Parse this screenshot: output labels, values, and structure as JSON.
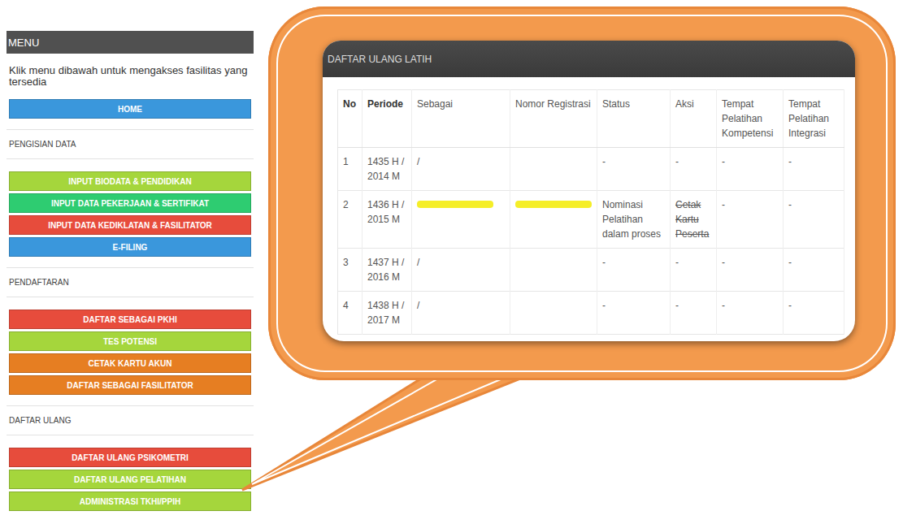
{
  "sidebar": {
    "title": "MENU",
    "intro": "Klik menu dibawah untuk mengakses fasilitas yang tersedia",
    "top_items": [
      {
        "label": "HOME",
        "color": "#3a97dc"
      }
    ],
    "sections": [
      {
        "label": "PENGISIAN DATA",
        "items": [
          {
            "label": "INPUT BIODATA & PENDIDIKAN",
            "color": "#a5d63c"
          },
          {
            "label": "INPUT DATA PEKERJAAN & SERTIFIKAT",
            "color": "#2ecc71"
          },
          {
            "label": "INPUT DATA KEDIKLATAN & FASILITATOR",
            "color": "#e74c3c"
          },
          {
            "label": "E-FILING",
            "color": "#3a97dc"
          }
        ]
      },
      {
        "label": "PENDAFTARAN",
        "items": [
          {
            "label": "DAFTAR SEBAGAI PKHI",
            "color": "#e74c3c"
          },
          {
            "label": "TES POTENSI",
            "color": "#a5d63c"
          },
          {
            "label": "CETAK KARTU AKUN",
            "color": "#e67e22"
          },
          {
            "label": "DAFTAR SEBAGAI FASILITATOR",
            "color": "#e67e22"
          }
        ]
      },
      {
        "label": "DAFTAR ULANG",
        "items": [
          {
            "label": "DAFTAR ULANG PSIKOMETRI",
            "color": "#e74c3c"
          },
          {
            "label": "DAFTAR ULANG PELATIHAN",
            "color": "#a5d63c"
          },
          {
            "label": "ADMINISTRASI TKHI/PPIH",
            "color": "#a5d63c"
          }
        ]
      }
    ]
  },
  "callout": {
    "panel_title": "DAFTAR ULANG LATIH",
    "table": {
      "columns": [
        {
          "label": "No",
          "bold": true
        },
        {
          "label": "Periode",
          "bold": true
        },
        {
          "label": "Sebagai",
          "bold": false
        },
        {
          "label": "Nomor Registrasi",
          "bold": false
        },
        {
          "label": "Status",
          "bold": false
        },
        {
          "label": "Aksi",
          "bold": false
        },
        {
          "label": "Tempat Pelatihan Kompetensi",
          "bold": false
        },
        {
          "label": "Tempat Pelatihan Integrasi",
          "bold": false
        }
      ],
      "rows": [
        {
          "cells": [
            {
              "text": "1",
              "redacted": false,
              "struck": false
            },
            {
              "text": "1435 H / 2014 M",
              "redacted": false,
              "struck": false
            },
            {
              "text": "/",
              "redacted": false,
              "struck": false
            },
            {
              "text": "",
              "redacted": false,
              "struck": false
            },
            {
              "text": "-",
              "redacted": false,
              "struck": false
            },
            {
              "text": "-",
              "redacted": false,
              "struck": false
            },
            {
              "text": "-",
              "redacted": false,
              "struck": false
            },
            {
              "text": "-",
              "redacted": false,
              "struck": false
            }
          ]
        },
        {
          "cells": [
            {
              "text": "2",
              "redacted": false,
              "struck": false
            },
            {
              "text": "1436 H / 2015 M",
              "redacted": false,
              "struck": false
            },
            {
              "text": "",
              "redacted": true,
              "struck": false
            },
            {
              "text": "",
              "redacted": true,
              "struck": false
            },
            {
              "text": "Nominasi Pelatihan dalam proses",
              "redacted": false,
              "struck": false
            },
            {
              "text": "Cetak Kartu Peserta",
              "redacted": false,
              "struck": true
            },
            {
              "text": "-",
              "redacted": false,
              "struck": false
            },
            {
              "text": "-",
              "redacted": false,
              "struck": false
            }
          ]
        },
        {
          "cells": [
            {
              "text": "3",
              "redacted": false,
              "struck": false
            },
            {
              "text": "1437 H / 2016 M",
              "redacted": false,
              "struck": false
            },
            {
              "text": "/",
              "redacted": false,
              "struck": false
            },
            {
              "text": "",
              "redacted": false,
              "struck": false
            },
            {
              "text": "-",
              "redacted": false,
              "struck": false
            },
            {
              "text": "-",
              "redacted": false,
              "struck": false
            },
            {
              "text": "-",
              "redacted": false,
              "struck": false
            },
            {
              "text": "-",
              "redacted": false,
              "struck": false
            }
          ]
        },
        {
          "cells": [
            {
              "text": "4",
              "redacted": false,
              "struck": false
            },
            {
              "text": "1438 H / 2017 M",
              "redacted": false,
              "struck": false
            },
            {
              "text": "/",
              "redacted": false,
              "struck": false
            },
            {
              "text": "",
              "redacted": false,
              "struck": false
            },
            {
              "text": "-",
              "redacted": false,
              "struck": false
            },
            {
              "text": "-",
              "redacted": false,
              "struck": false
            },
            {
              "text": "-",
              "redacted": false,
              "struck": false
            },
            {
              "text": "-",
              "redacted": false,
              "struck": false
            }
          ]
        }
      ]
    }
  }
}
